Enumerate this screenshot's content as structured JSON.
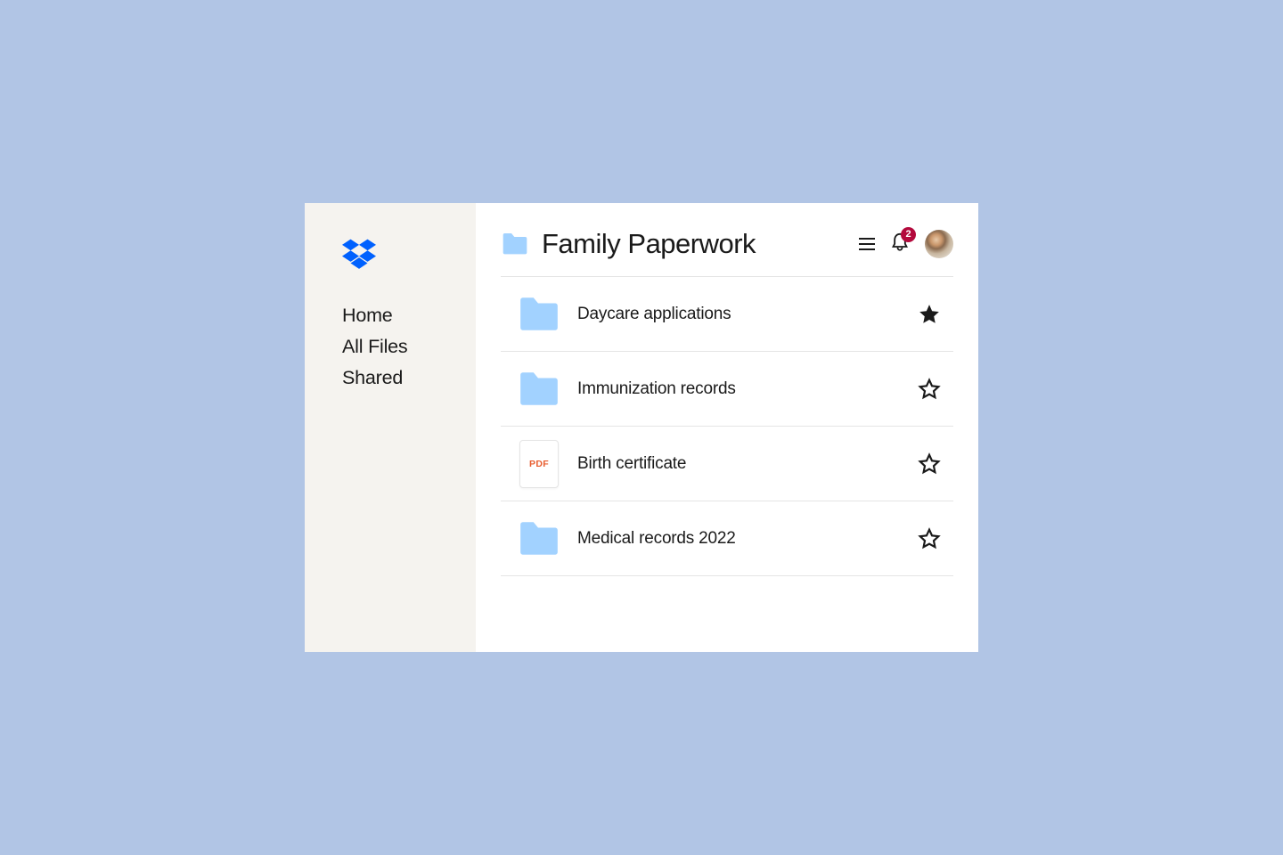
{
  "sidebar": {
    "items": [
      {
        "label": "Home"
      },
      {
        "label": "All Files"
      },
      {
        "label": "Shared"
      }
    ]
  },
  "header": {
    "title": "Family Paperwork",
    "notification_count": "2"
  },
  "files": [
    {
      "name": "Daycare applications",
      "type": "folder",
      "starred": true
    },
    {
      "name": "Immunization records",
      "type": "folder",
      "starred": false
    },
    {
      "name": "Birth certificate",
      "type": "pdf",
      "starred": false
    },
    {
      "name": "Medical records 2022",
      "type": "folder",
      "starred": false
    }
  ],
  "colors": {
    "folder": "#a2d2ff",
    "brand": "#0061fe"
  },
  "labels": {
    "pdf": "PDF"
  }
}
